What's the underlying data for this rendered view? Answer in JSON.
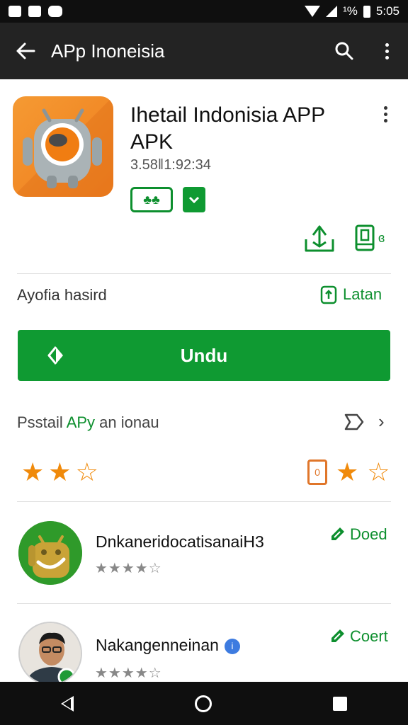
{
  "status_bar": {
    "indicator": "¹%",
    "time": "5:05"
  },
  "app_bar": {
    "title": "APp Inoneisia",
    "back_icon": "arrow-left-icon",
    "search_icon": "search-icon",
    "more_icon": "more-vertical-icon"
  },
  "app": {
    "title": "Ihetail Indonisia APP APK",
    "meta": "3.58‖1:92:34",
    "badge_text": "♣♣",
    "icon": "android-robot-icon",
    "install_icon": "install-icon",
    "phone_icon": "phone-icon",
    "phone_label": "ɞ"
  },
  "info": {
    "label": "Ayofia hasird",
    "latest_label": "Latan"
  },
  "download": {
    "label": "Undu",
    "icon": "download-arrow-icon"
  },
  "description": {
    "prefix": "Psstail ",
    "accent": "APy",
    "suffix": " an ionau"
  },
  "rating": {
    "stars_left": [
      1,
      1,
      0
    ],
    "stars_right": [
      1,
      0
    ],
    "tag_icon": "tag-icon"
  },
  "related": [
    {
      "name": "DnkaneridocatisanaiH3",
      "stars": "★★★★☆",
      "action": "Doed",
      "icon": "android-avatar-icon"
    },
    {
      "name": "Nakangenneinan",
      "stars": "★★★★☆",
      "action": "Coert",
      "icon": "person-avatar-icon",
      "verified": "i"
    }
  ],
  "colors": {
    "accent": "#0f9a32",
    "star": "#f08a0b",
    "app_bar": "#232323"
  }
}
